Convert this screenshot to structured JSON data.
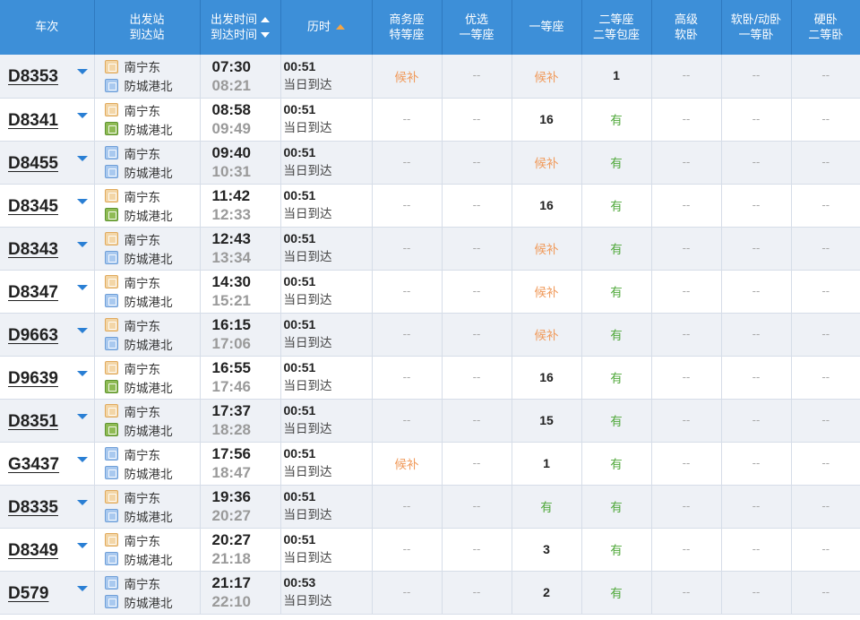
{
  "header": {
    "train": "车次",
    "station_from": "出发站",
    "station_to": "到达站",
    "time_dep": "出发时间",
    "time_arr": "到达时间",
    "duration": "历时",
    "seat_cols": [
      [
        "商务座",
        "特等座"
      ],
      [
        "优选",
        "一等座"
      ],
      [
        "一等座"
      ],
      [
        "二等座",
        "二等包座"
      ],
      [
        "高级",
        "软卧"
      ],
      [
        "软卧/动卧",
        "一等卧"
      ],
      [
        "硬卧",
        "二等卧"
      ]
    ]
  },
  "colors": {
    "header_bg": "#3d8fd8",
    "row_alt": "#eef1f6",
    "wait": "#f09a5b",
    "available": "#4fa83a",
    "caret": "#2a7fd4"
  },
  "icons": {
    "start": "始",
    "pass": "过",
    "end": "终"
  },
  "rows": [
    {
      "train": "D8353",
      "from": "南宁东",
      "from_type": "start",
      "to": "防城港北",
      "to_type": "pass",
      "dep": "07:30",
      "arr": "08:21",
      "dur": "00:51",
      "day": "当日到达",
      "seats": [
        "候补",
        "--",
        "候补",
        "1",
        "--",
        "--",
        "--"
      ]
    },
    {
      "train": "D8341",
      "from": "南宁东",
      "from_type": "start",
      "to": "防城港北",
      "to_type": "end",
      "dep": "08:58",
      "arr": "09:49",
      "dur": "00:51",
      "day": "当日到达",
      "seats": [
        "--",
        "--",
        "16",
        "有",
        "--",
        "--",
        "--"
      ]
    },
    {
      "train": "D8455",
      "from": "南宁东",
      "from_type": "pass",
      "to": "防城港北",
      "to_type": "pass",
      "dep": "09:40",
      "arr": "10:31",
      "dur": "00:51",
      "day": "当日到达",
      "seats": [
        "--",
        "--",
        "候补",
        "有",
        "--",
        "--",
        "--"
      ]
    },
    {
      "train": "D8345",
      "from": "南宁东",
      "from_type": "start",
      "to": "防城港北",
      "to_type": "end",
      "dep": "11:42",
      "arr": "12:33",
      "dur": "00:51",
      "day": "当日到达",
      "seats": [
        "--",
        "--",
        "16",
        "有",
        "--",
        "--",
        "--"
      ]
    },
    {
      "train": "D8343",
      "from": "南宁东",
      "from_type": "start",
      "to": "防城港北",
      "to_type": "pass",
      "dep": "12:43",
      "arr": "13:34",
      "dur": "00:51",
      "day": "当日到达",
      "seats": [
        "--",
        "--",
        "候补",
        "有",
        "--",
        "--",
        "--"
      ]
    },
    {
      "train": "D8347",
      "from": "南宁东",
      "from_type": "start",
      "to": "防城港北",
      "to_type": "pass",
      "dep": "14:30",
      "arr": "15:21",
      "dur": "00:51",
      "day": "当日到达",
      "seats": [
        "--",
        "--",
        "候补",
        "有",
        "--",
        "--",
        "--"
      ]
    },
    {
      "train": "D9663",
      "from": "南宁东",
      "from_type": "start",
      "to": "防城港北",
      "to_type": "pass",
      "dep": "16:15",
      "arr": "17:06",
      "dur": "00:51",
      "day": "当日到达",
      "seats": [
        "--",
        "--",
        "候补",
        "有",
        "--",
        "--",
        "--"
      ]
    },
    {
      "train": "D9639",
      "from": "南宁东",
      "from_type": "start",
      "to": "防城港北",
      "to_type": "end",
      "dep": "16:55",
      "arr": "17:46",
      "dur": "00:51",
      "day": "当日到达",
      "seats": [
        "--",
        "--",
        "16",
        "有",
        "--",
        "--",
        "--"
      ]
    },
    {
      "train": "D8351",
      "from": "南宁东",
      "from_type": "start",
      "to": "防城港北",
      "to_type": "end",
      "dep": "17:37",
      "arr": "18:28",
      "dur": "00:51",
      "day": "当日到达",
      "seats": [
        "--",
        "--",
        "15",
        "有",
        "--",
        "--",
        "--"
      ]
    },
    {
      "train": "G3437",
      "from": "南宁东",
      "from_type": "pass",
      "to": "防城港北",
      "to_type": "pass",
      "dep": "17:56",
      "arr": "18:47",
      "dur": "00:51",
      "day": "当日到达",
      "seats": [
        "候补",
        "--",
        "1",
        "有",
        "--",
        "--",
        "--"
      ]
    },
    {
      "train": "D8335",
      "from": "南宁东",
      "from_type": "start",
      "to": "防城港北",
      "to_type": "pass",
      "dep": "19:36",
      "arr": "20:27",
      "dur": "00:51",
      "day": "当日到达",
      "seats": [
        "--",
        "--",
        "有",
        "有",
        "--",
        "--",
        "--"
      ]
    },
    {
      "train": "D8349",
      "from": "南宁东",
      "from_type": "start",
      "to": "防城港北",
      "to_type": "pass",
      "dep": "20:27",
      "arr": "21:18",
      "dur": "00:51",
      "day": "当日到达",
      "seats": [
        "--",
        "--",
        "3",
        "有",
        "--",
        "--",
        "--"
      ]
    },
    {
      "train": "D579",
      "from": "南宁东",
      "from_type": "pass",
      "to": "防城港北",
      "to_type": "pass",
      "dep": "21:17",
      "arr": "22:10",
      "dur": "00:53",
      "day": "当日到达",
      "seats": [
        "--",
        "--",
        "2",
        "有",
        "--",
        "--",
        "--"
      ]
    }
  ]
}
